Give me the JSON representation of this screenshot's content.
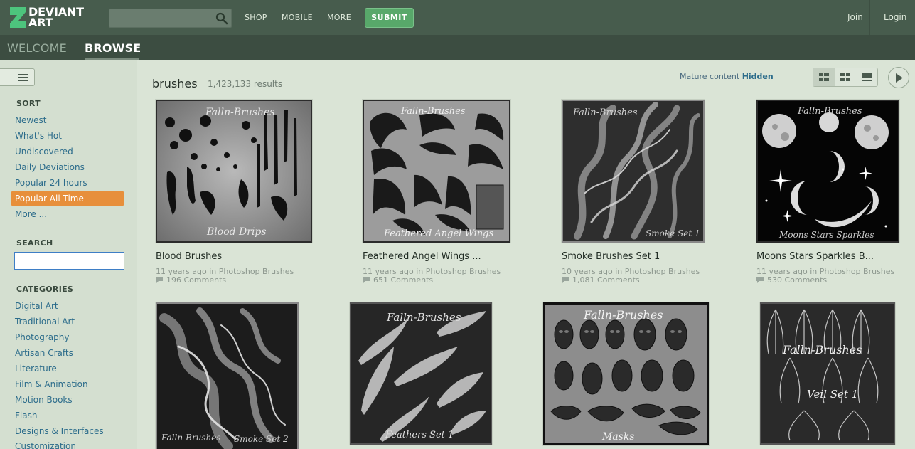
{
  "header": {
    "logo_line1": "DEVIANT",
    "logo_line2": "ART",
    "search_placeholder": "",
    "nav": [
      "SHOP",
      "MOBILE",
      "MORE"
    ],
    "submit_label": "SUBMIT",
    "join_label": "Join",
    "login_label": "Login"
  },
  "subnav": {
    "welcome": "WELCOME",
    "browse": "BROWSE"
  },
  "sidebar": {
    "sort_heading": "SORT",
    "sort_items": [
      "Newest",
      "What's Hot",
      "Undiscovered",
      "Daily Deviations",
      "Popular 24 hours",
      "Popular All Time",
      "More ..."
    ],
    "sort_active": "Popular All Time",
    "search_heading": "SEARCH",
    "search_value": "",
    "categories_heading": "CATEGORIES",
    "categories": [
      "Digital Art",
      "Traditional Art",
      "Photography",
      "Artisan Crafts",
      "Literature",
      "Film & Animation",
      "Motion Books",
      "Flash",
      "Designs & Interfaces",
      "Customization"
    ]
  },
  "main": {
    "query": "brushes",
    "results": "1,423,133 results",
    "mature_label": "Mature content",
    "mature_state": "Hidden",
    "colors": {
      "accent_orange": "#e78f3b",
      "submit_green": "#58a86a",
      "link_blue": "#2c6c8b"
    }
  },
  "items": [
    {
      "title": "Blood Brushes",
      "meta": "11 years ago in Photoshop Brushes",
      "comments": "196 Comments",
      "watermark": "Falln-Brushes",
      "caption": "Blood Drips"
    },
    {
      "title": "Feathered Angel Wings ...",
      "meta": "11 years ago in Photoshop Brushes",
      "comments": "651 Comments",
      "watermark": "Falln-Brushes",
      "caption": "Feathered Angel Wings"
    },
    {
      "title": "Smoke Brushes Set 1",
      "meta": "10 years ago in Photoshop Brushes",
      "comments": "1,081 Comments",
      "watermark": "Falln-Brushes",
      "caption": "Smoke Set 1"
    },
    {
      "title": "Moons Stars Sparkles B...",
      "meta": "11 years ago in Photoshop Brushes",
      "comments": "530 Comments",
      "watermark": "Falln-Brushes",
      "caption": "Moons Stars Sparkles"
    },
    {
      "watermark": "Falln-Brushes",
      "caption": "Smoke Set 2"
    },
    {
      "watermark": "Falln-Brushes",
      "caption": "Feathers Set 1"
    },
    {
      "watermark": "Falln-Brushes",
      "caption": "Masks"
    },
    {
      "watermark": "Falln-Brushes",
      "caption": "Veil Set 1"
    }
  ]
}
